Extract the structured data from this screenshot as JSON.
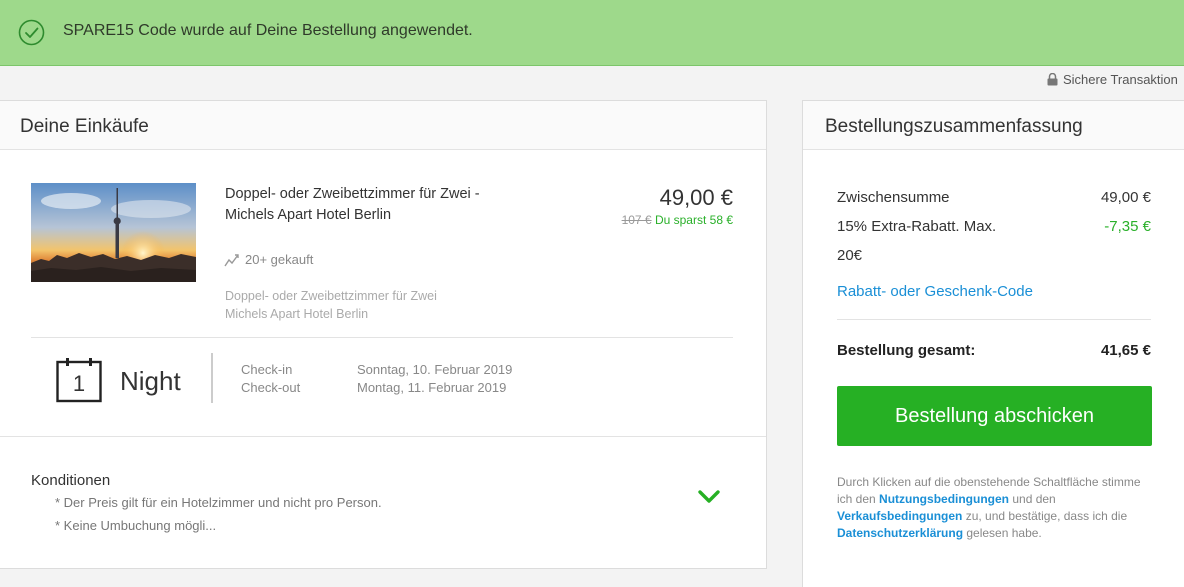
{
  "banner": {
    "message": "SPARE15 Code wurde auf Deine Bestellung angewendet."
  },
  "secure": {
    "label": "Sichere Transaktion"
  },
  "cart": {
    "title": "Deine Einkäufe",
    "item": {
      "title": "Doppel- oder Zweibettzimmer für Zwei - Michels Apart Hotel Berlin",
      "price": "49,00 €",
      "old_price": "107 €",
      "savings": "Du sparst 58 €",
      "bought": "20+ gekauft",
      "subtitle_line1": "Doppel- oder Zweibettzimmer für Zwei",
      "subtitle_line2": "Michels Apart Hotel Berlin"
    },
    "stay": {
      "nights": "1",
      "night_label": "Night",
      "checkin_label": "Check-in",
      "checkout_label": "Check-out",
      "checkin_date": "Sonntag, 10. Februar 2019",
      "checkout_date": "Montag, 11. Februar 2019"
    },
    "conditions": {
      "title": "Konditionen",
      "lines": [
        "* Der Preis gilt für ein Hotelzimmer und nicht pro Person.",
        "* Keine Umbuchung mögli..."
      ]
    }
  },
  "summary": {
    "title": "Bestellungszusammenfassung",
    "subtotal_label": "Zwischensumme",
    "subtotal_value": "49,00 €",
    "discount_label_line1": "15% Extra-Rabatt. Max.",
    "discount_label_line2": "20€",
    "discount_value": "-7,35 €",
    "coupon_link": "Rabatt- oder Geschenk-Code",
    "total_label": "Bestellung gesamt:",
    "total_value": "41,65 €",
    "submit_label": "Bestellung abschicken",
    "legal": {
      "part1": "Durch Klicken auf die obenstehende Schaltfläche stimme ich den ",
      "terms_link": "Nutzungsbedingungen",
      "part2": " und den ",
      "sales_link": "Verkaufsbedingungen",
      "part3": " zu, und bestätige, dass ich die ",
      "privacy_link": "Datenschutzerklärung",
      "part4": " gelesen habe."
    }
  },
  "colors": {
    "banner_bg": "#9ed98b",
    "accent_green": "#26b024",
    "link_blue": "#1a8fd6"
  },
  "icons": {
    "banner": "check-circle-icon",
    "secure": "lock-icon",
    "bought": "trend-icon",
    "calendar": "calendar-icon",
    "conditions_toggle": "chevron-down-icon"
  }
}
